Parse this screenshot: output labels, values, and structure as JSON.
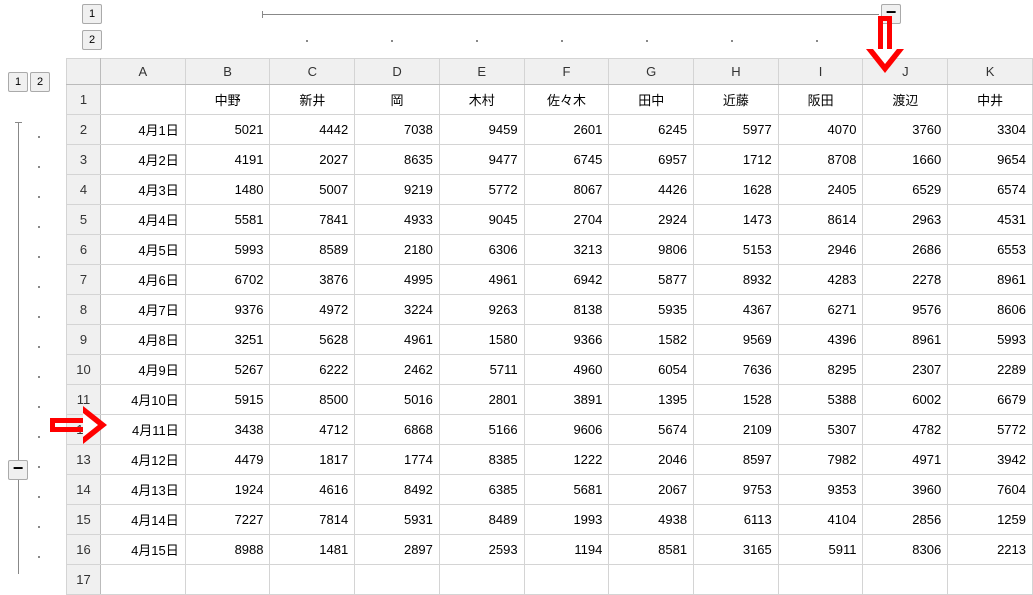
{
  "outline": {
    "col_levels": [
      "1",
      "2"
    ],
    "row_levels": [
      "1",
      "2"
    ],
    "collapse_label": "−"
  },
  "columns": [
    "A",
    "B",
    "C",
    "D",
    "E",
    "F",
    "G",
    "H",
    "I",
    "J",
    "K"
  ],
  "header_row_num": "1",
  "names": [
    "",
    "中野",
    "新井",
    "岡",
    "木村",
    "佐々木",
    "田中",
    "近藤",
    "阪田",
    "渡辺",
    "中井"
  ],
  "rows": [
    {
      "n": "2",
      "date": "4月1日",
      "v": [
        5021,
        4442,
        7038,
        9459,
        2601,
        6245,
        5977,
        4070,
        3760,
        3304
      ]
    },
    {
      "n": "3",
      "date": "4月2日",
      "v": [
        4191,
        2027,
        8635,
        9477,
        6745,
        6957,
        1712,
        8708,
        1660,
        9654
      ]
    },
    {
      "n": "4",
      "date": "4月3日",
      "v": [
        1480,
        5007,
        9219,
        5772,
        8067,
        4426,
        1628,
        2405,
        6529,
        6574
      ]
    },
    {
      "n": "5",
      "date": "4月4日",
      "v": [
        5581,
        7841,
        4933,
        9045,
        2704,
        2924,
        1473,
        8614,
        2963,
        4531
      ]
    },
    {
      "n": "6",
      "date": "4月5日",
      "v": [
        5993,
        8589,
        2180,
        6306,
        3213,
        9806,
        5153,
        2946,
        2686,
        6553
      ]
    },
    {
      "n": "7",
      "date": "4月6日",
      "v": [
        6702,
        3876,
        4995,
        4961,
        6942,
        5877,
        8932,
        4283,
        2278,
        8961
      ]
    },
    {
      "n": "8",
      "date": "4月7日",
      "v": [
        9376,
        4972,
        3224,
        9263,
        8138,
        5935,
        4367,
        6271,
        9576,
        8606
      ]
    },
    {
      "n": "9",
      "date": "4月8日",
      "v": [
        3251,
        5628,
        4961,
        1580,
        9366,
        1582,
        9569,
        4396,
        8961,
        5993
      ]
    },
    {
      "n": "10",
      "date": "4月9日",
      "v": [
        5267,
        6222,
        2462,
        5711,
        4960,
        6054,
        7636,
        8295,
        2307,
        2289
      ]
    },
    {
      "n": "11",
      "date": "4月10日",
      "v": [
        5915,
        8500,
        5016,
        2801,
        3891,
        1395,
        1528,
        5388,
        6002,
        6679
      ]
    },
    {
      "n": "12",
      "date": "4月11日",
      "v": [
        3438,
        4712,
        6868,
        5166,
        9606,
        5674,
        2109,
        5307,
        4782,
        5772
      ]
    },
    {
      "n": "13",
      "date": "4月12日",
      "v": [
        4479,
        1817,
        1774,
        8385,
        1222,
        2046,
        8597,
        7982,
        4971,
        3942
      ]
    },
    {
      "n": "14",
      "date": "4月13日",
      "v": [
        1924,
        4616,
        8492,
        6385,
        5681,
        2067,
        9753,
        9353,
        3960,
        7604
      ]
    },
    {
      "n": "15",
      "date": "4月14日",
      "v": [
        7227,
        7814,
        5931,
        8489,
        1993,
        4938,
        6113,
        4104,
        2856,
        1259
      ]
    },
    {
      "n": "16",
      "date": "4月15日",
      "v": [
        8988,
        1481,
        2897,
        2593,
        1194,
        8581,
        3165,
        5911,
        8306,
        2213
      ]
    }
  ],
  "empty_row_num": "17"
}
